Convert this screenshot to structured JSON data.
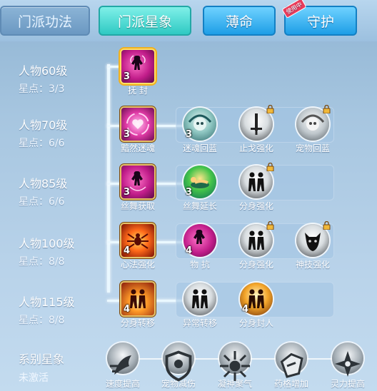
{
  "tabs": [
    {
      "label": "门派功法",
      "state": "inactive"
    },
    {
      "label": "门派星象",
      "state": "active"
    },
    {
      "label": "薄命",
      "state": "blue"
    },
    {
      "label": "守护",
      "state": "blue",
      "badge": "使用中"
    }
  ],
  "rows": [
    {
      "level": "人物60级",
      "points": "星点：3/3",
      "skills": [
        {
          "name": "抚 封",
          "count": "3",
          "icon": "dancer-icon",
          "locked": false
        }
      ]
    },
    {
      "level": "人物70级",
      "points": "星点：6/6",
      "skills": [
        {
          "name": "黯然迷魂",
          "count": "3",
          "icon": "heart-swirl-icon",
          "locked": false
        },
        {
          "name": "迷魂回蓝",
          "count": "3",
          "icon": "skull-swirl-icon",
          "locked": false
        },
        {
          "name": "止戈强化",
          "count": "",
          "icon": "sword-icon",
          "locked": true
        },
        {
          "name": "宠物回蓝",
          "count": "",
          "icon": "skull-swirl-icon",
          "locked": true
        }
      ]
    },
    {
      "level": "人物85级",
      "points": "星点：6/6",
      "skills": [
        {
          "name": "丝舞获取",
          "count": "3",
          "icon": "dancer-icon",
          "locked": false
        },
        {
          "name": "丝舞延长",
          "count": "3",
          "icon": "reclining-figure-icon",
          "locked": false
        },
        {
          "name": "分身强化",
          "count": "",
          "icon": "twin-figures-icon",
          "locked": true
        }
      ]
    },
    {
      "level": "人物100级",
      "points": "星点：8/8",
      "skills": [
        {
          "name": "心法强化",
          "count": "4",
          "icon": "spider-icon",
          "locked": false
        },
        {
          "name": "物 抗",
          "count": "4",
          "icon": "dancer-icon",
          "locked": false
        },
        {
          "name": "分身强化",
          "count": "",
          "icon": "twin-figures-icon",
          "locked": true
        },
        {
          "name": "神技强化",
          "count": "",
          "icon": "demon-icon",
          "locked": true
        }
      ]
    },
    {
      "level": "人物115级",
      "points": "星点：8/8",
      "skills": [
        {
          "name": "分身转移",
          "count": "4",
          "icon": "twin-figures-icon",
          "locked": false
        },
        {
          "name": "异常转移",
          "count": "",
          "icon": "twin-figures-icon",
          "locked": false
        },
        {
          "name": "分身封人",
          "count": "4",
          "icon": "twin-figures-icon",
          "locked": false
        }
      ]
    }
  ],
  "constellation": {
    "title": "系别星象",
    "status": "未激活",
    "items": [
      {
        "name": "速度提高",
        "icon": "speed-icon"
      },
      {
        "name": "宠物减伤",
        "icon": "pet-shield-icon"
      },
      {
        "name": "凝神聚气",
        "icon": "focus-icon"
      },
      {
        "name": "药格增加",
        "icon": "potion-icon"
      },
      {
        "name": "灵力提高",
        "icon": "spirit-icon"
      }
    ]
  }
}
